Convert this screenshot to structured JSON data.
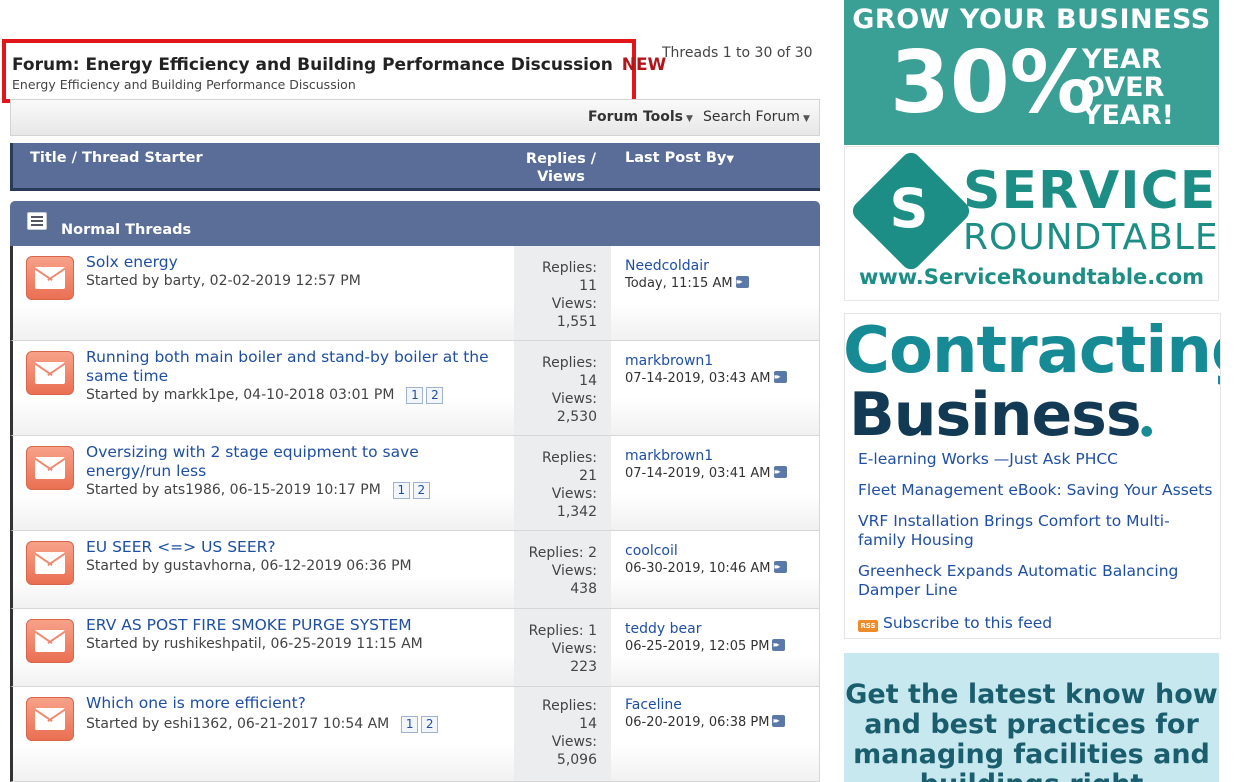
{
  "forum": {
    "title_prefix": "Forum: Energy Efficiency and Building Performance Discussion",
    "new_badge": "NEW",
    "subtitle": "Energy Efficiency and Building Performance Discussion",
    "thread_count": "Threads 1 to 30 of 30"
  },
  "tools": {
    "forum_tools": "Forum Tools",
    "search_forum": "Search Forum"
  },
  "columns": {
    "title": "Title / Thread Starter",
    "replies_line1": "Replies /",
    "replies_line2": "Views",
    "last_post": "Last Post By"
  },
  "section": {
    "label": "Normal Threads"
  },
  "threads": [
    {
      "title": "Solx energy",
      "started": "Started by barty, 02-02-2019 12:57 PM",
      "replies_label": "Replies:",
      "replies": "11",
      "views_label": "Views:",
      "views": "1,551",
      "last_user": "Needcoldair",
      "last_time": "Today, 11:15 AM"
    },
    {
      "title": "Running both main boiler and stand-by boiler at the same time",
      "started": "Started by markk1pe, 04-10-2018 03:01 PM",
      "pages": [
        "1",
        "2"
      ],
      "replies_label": "Replies:",
      "replies": "14",
      "views_label": "Views:",
      "views": "2,530",
      "last_user": "markbrown1",
      "last_time": "07-14-2019, 03:43 AM"
    },
    {
      "title": "Oversizing with 2 stage equipment to save energy/run less",
      "started": "Started by ats1986, 06-15-2019 10:17 PM",
      "pages": [
        "1",
        "2"
      ],
      "replies_label": "Replies:",
      "replies": "21",
      "views_label": "Views:",
      "views": "1,342",
      "last_user": "markbrown1",
      "last_time": "07-14-2019, 03:41 AM"
    },
    {
      "title": "EU SEER <=> US SEER?",
      "started": "Started by gustavhorna, 06-12-2019 06:36 PM",
      "replies_label": "Replies: 2",
      "replies": "",
      "views_label": "Views:",
      "views": "438",
      "last_user": "coolcoil",
      "last_time": "06-30-2019, 10:46 AM"
    },
    {
      "title": "ERV AS POST FIRE SMOKE PURGE SYSTEM",
      "started": "Started by rushikeshpatil, 06-25-2019 11:15 AM",
      "replies_label": "Replies: 1",
      "replies": "",
      "views_label": "Views:",
      "views": "223",
      "last_user": "teddy bear",
      "last_time": "06-25-2019, 12:05 PM"
    },
    {
      "title": "Which one is more efficient?",
      "started": "Started by eshi1362, 06-21-2017 10:54 AM",
      "pages": [
        "1",
        "2"
      ],
      "replies_label": "Replies:",
      "replies": "14",
      "views_label": "Views:",
      "views": "5,096",
      "last_user": "Faceline",
      "last_time": "06-20-2019, 06:38 PM"
    }
  ],
  "ads": {
    "grow": {
      "line1": "GROW YOUR BUSINESS",
      "percent": "30%",
      "year": "YEAR",
      "over": "OVER",
      "year2": "YEAR!"
    },
    "service": {
      "logo_letter": "S",
      "word1": "SERVICE",
      "word2": "ROUNDTABLE",
      "url": "www.ServiceRoundtable.com"
    },
    "contracting": {
      "word1": "Contracting",
      "word2": "Business",
      "feed": [
        "E-learning Works —Just Ask PHCC",
        "Fleet Management eBook: Saving Your Assets",
        "VRF Installation Brings Comfort to Multi-family Housing",
        "Greenheck Expands Automatic Balancing Damper Line"
      ],
      "rss_badge": "RSS",
      "subscribe": "Subscribe to this feed"
    },
    "facilities": {
      "text": "Get the latest know how and best practices for managing facilities and buildings right"
    }
  },
  "colors": {
    "header_blue": "#596d98",
    "link_blue": "#1f4fa3",
    "highlight_red": "#e0161b",
    "teal": "#3a9f95"
  }
}
